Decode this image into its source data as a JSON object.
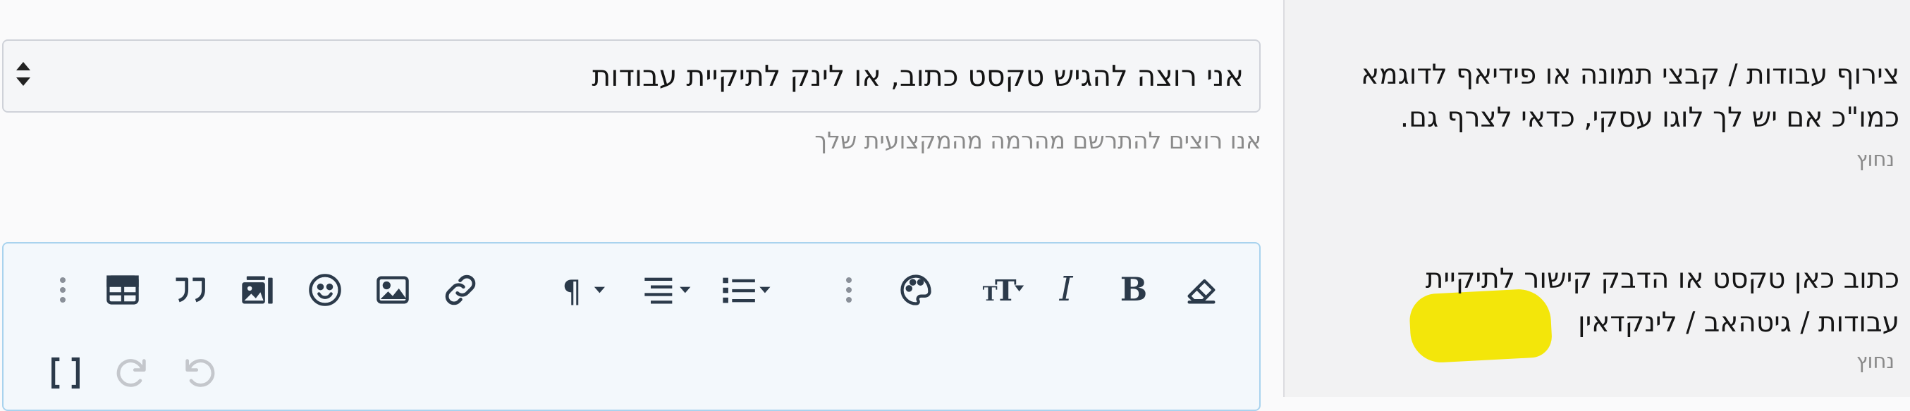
{
  "sidebar": {
    "field1": {
      "line1": "צירוף עבודות / קבצי תמונה או פידיאף לדוגמא",
      "line2": "כמו\"כ אם יש לך לוגו עסקי, כדאי לצרף גם.",
      "required": "נחוץ"
    },
    "field2": {
      "line1": "כתוב כאן טקסט או הדבק קישור לתיקיית",
      "line2": "עבודות / גיטהאב / לינקדאין",
      "required": "נחוץ",
      "highlight_color": "#f3e60a"
    }
  },
  "select": {
    "value": "אני רוצה להגיש טקסט כתוב, או לינק לתיקיית עבודות"
  },
  "hint": "אנו רוצים להתרשם מהרמה מהמקצועית שלך",
  "colors": {
    "editor_border": "#a9d3ee",
    "editor_bg": "#f3f8fc",
    "icon": "#2b3a4a",
    "icon_disabled": "#c4c7cc"
  },
  "toolbar": {
    "icons": [
      "eraser-icon",
      "bold-icon",
      "italic-icon",
      "text-size-icon",
      "palette-icon",
      "more-options-icon",
      "list-icon",
      "align-icon",
      "paragraph-icon",
      "link-icon",
      "image-icon",
      "emoji-icon",
      "media-gallery-icon",
      "quote-icon",
      "table-icon",
      "more-insert-icon",
      "undo-icon",
      "redo-icon",
      "bbcode-icon"
    ]
  }
}
